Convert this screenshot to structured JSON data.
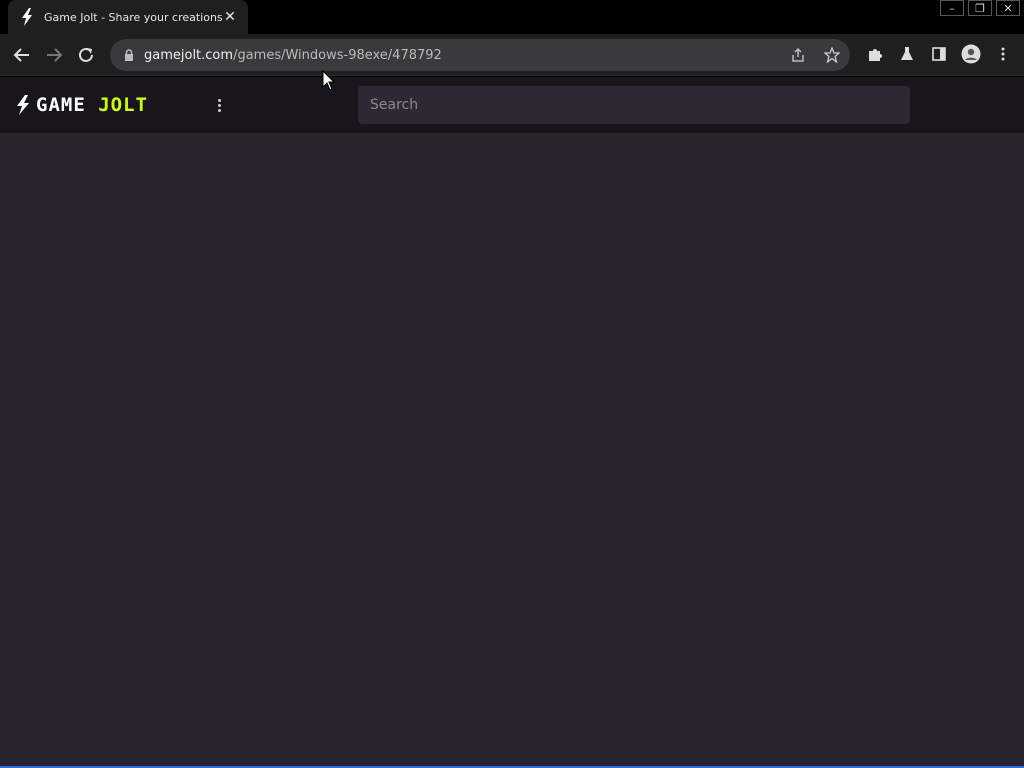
{
  "browser": {
    "tab": {
      "title": "Game Jolt - Share your creations",
      "close_glyph": "✕",
      "favicon": "gamejolt-bolt-icon"
    },
    "window_controls": [
      "–",
      "❐",
      "✕"
    ],
    "address": {
      "host": "gamejolt.com",
      "path": "/games/Windows-98exe/478792"
    }
  },
  "site": {
    "logo": {
      "word1": "GAME",
      "word2": "JOLT",
      "accent_color": "#ccff00"
    },
    "search": {
      "placeholder": "Search",
      "value": ""
    }
  },
  "colors": {
    "page_bg": "#28252f",
    "header_bg": "#18161c",
    "search_bg": "#2c2934"
  }
}
